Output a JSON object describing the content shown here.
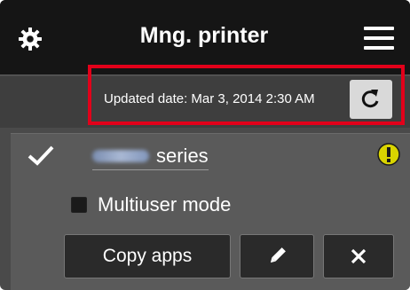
{
  "header": {
    "title": "Mng. printer",
    "left_icon": "gear-icon",
    "right_icon": "hamburger-menu-icon"
  },
  "update": {
    "text": "Updated date: Mar 3, 2014 2:30 AM",
    "refresh_icon": "refresh-icon"
  },
  "printer": {
    "name_suffix": "series",
    "status_icon": "check-icon",
    "alert_icon": "alert-icon",
    "multiuser_label": "Multiuser mode",
    "multiuser_checked": false,
    "copy_label": "Copy apps",
    "edit_icon": "pencil-icon",
    "delete_icon": "close-icon"
  },
  "colors": {
    "header_bg": "#151515",
    "panel_bg": "#4a4a4a",
    "card_bg": "#5a5a5a",
    "highlight": "#e2001a",
    "alert": "#d9d400",
    "button_bg": "#2a2a2a"
  }
}
